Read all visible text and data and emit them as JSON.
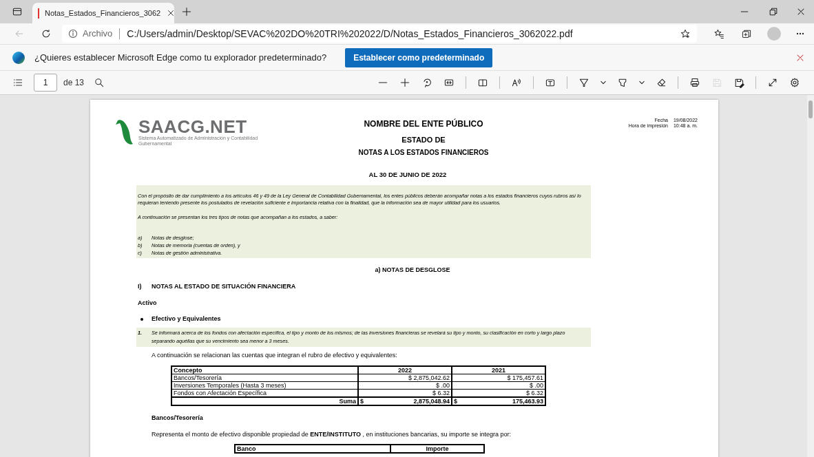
{
  "browser": {
    "tab": {
      "title": "Notas_Estados_Financieros_3062"
    },
    "address": {
      "scheme_label": "Archivo",
      "url": "C:/Users/admin/Desktop/SEVAC%202DO%20TRI%202022/D/Notas_Estados_Financieros_3062022.pdf"
    },
    "back_disabled": true
  },
  "infobar": {
    "message": "¿Quieres establecer Microsoft Edge como tu explorador predeterminado?",
    "button": "Establecer como predeterminado"
  },
  "pdf_toolbar": {
    "page": "1",
    "page_count": "de 13",
    "tools": [
      {
        "kind": "zoom-out",
        "disabled": false
      },
      {
        "kind": "zoom-in",
        "disabled": false
      },
      {
        "kind": "rotate",
        "disabled": false
      },
      {
        "kind": "fit",
        "disabled": false
      },
      {
        "kind": "sep"
      },
      {
        "kind": "page-view",
        "disabled": false
      },
      {
        "kind": "sep"
      },
      {
        "kind": "read-aloud",
        "disabled": false
      },
      {
        "kind": "sep"
      },
      {
        "kind": "text",
        "disabled": false
      },
      {
        "kind": "sep"
      },
      {
        "kind": "draw",
        "disabled": false
      },
      {
        "kind": "chevron",
        "disabled": false
      },
      {
        "kind": "highlight",
        "disabled": false
      },
      {
        "kind": "chevron",
        "disabled": false
      },
      {
        "kind": "eraser",
        "disabled": false
      },
      {
        "kind": "sep"
      },
      {
        "kind": "print",
        "disabled": false
      },
      {
        "kind": "save",
        "disabled": true
      },
      {
        "kind": "save-as",
        "disabled": false
      },
      {
        "kind": "sep"
      },
      {
        "kind": "fullscreen",
        "disabled": false
      },
      {
        "kind": "settings",
        "disabled": false
      }
    ]
  },
  "document": {
    "logo": {
      "name": "SAACG.NET",
      "subtitle": "Sistema Automatizado de Administración y Contabilidad Gubernamental"
    },
    "header": {
      "lines": [
        "NOMBRE DEL ENTE PÚBLICO",
        "ESTADO DE",
        "NOTAS A LOS ESTADOS FINANCIEROS"
      ],
      "date_label": "Fecha",
      "date": "19/08/2022",
      "time_label": "Hora de impresión",
      "time": "10:48 a. m."
    },
    "period": "AL 30 DE JUNIO DE 2022",
    "intro": {
      "paragraphs": [
        "Con el propósito de dar cumplimiento a los artículos 46 y 49 de la Ley General de Contabilidad Gubernamental, los entes públicos deberán acompañar notas a los estados financieros cuyos rubros así lo requieran teniendo presente los postulados de revelación suficiente e importancia relativa con la finalidad, que la información sea de mayor utilidad para los usuarios.",
        "A continuación se presentan los tres tipos de notas que acompañan a los estados, a saber:"
      ],
      "items": [
        {
          "marker": "a)",
          "text": "Notas de desglose;"
        },
        {
          "marker": "b)",
          "text": "Notas de memoria (cuentas de orden), y"
        },
        {
          "marker": "c)",
          "text": "Notas de gestión administrativa."
        }
      ]
    },
    "section_title": "a) NOTAS DE DESGLOSE",
    "heading": {
      "number": "I)",
      "text": "NOTAS AL ESTADO DE SITUACIÓN FINANCIERA"
    },
    "subheading": "Activo",
    "bullet": "Efectivo y Equivalentes",
    "note": {
      "number": "1.",
      "text": "Se informará acerca de los fondos con afectación específica, el tipo y monto de los mismos; de las inversiones financieras se revelará su tipo y monto, su clasificación en corto y largo plazo separando aquéllas que su vencimiento sea menor a 3 meses."
    },
    "table_intro": "A continuación se relacionan las cuentas que integran el rubro de efectivo y equivalentes:",
    "table": {
      "columns": [
        "Concepto",
        "2022",
        "2021"
      ],
      "rows": [
        [
          "Bancos/Tesorería",
          "$ 2,875,042.62",
          "$ 175,457.61"
        ],
        [
          "Inversiones Temporales (Hasta 3 meses)",
          "$ .00",
          "$ .00"
        ],
        [
          "Fondos con Afectación Específica",
          "$ 6.32",
          "$ 6.32"
        ]
      ],
      "total": {
        "label": "Suma",
        "cells": [
          {
            "currency": "$",
            "amount": "2,875,048.94"
          },
          {
            "currency": "$",
            "amount": "175,463.93"
          }
        ]
      }
    },
    "bank_heading": "Bancos/Tesorería",
    "bank_intro": "Representa el monto de efectivo disponible propiedad de **ENTE/INSTITUTO** , en instituciones bancarias, su importe se integra por:",
    "bank_table": {
      "columns": [
        "Banco",
        "Importe"
      ]
    }
  }
}
